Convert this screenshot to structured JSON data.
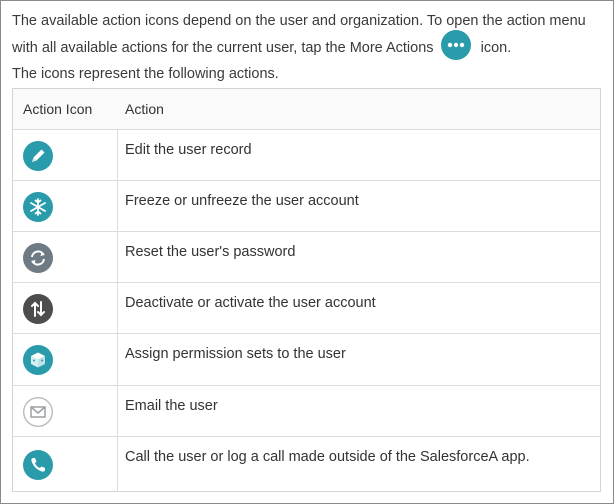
{
  "intro": {
    "text_before": "The available action icons depend on the user and organization. To open the action menu with all available actions for the current user, tap the More Actions",
    "text_after": "icon.",
    "more_actions_icon": "more-actions-icon"
  },
  "subintro": "The icons represent the following actions.",
  "table": {
    "headers": [
      "Action Icon",
      "Action"
    ],
    "rows": [
      {
        "icon": "edit-icon",
        "color": "#2a9bab",
        "action": "Edit the user record"
      },
      {
        "icon": "freeze-icon",
        "color": "#2a9bab",
        "action": "Freeze or unfreeze the user account"
      },
      {
        "icon": "reset-password-icon",
        "color": "#6f7b84",
        "action": "Reset the user's password"
      },
      {
        "icon": "deactivate-icon",
        "color": "#4d4d4d",
        "action": "Deactivate or activate the user account"
      },
      {
        "icon": "permission-sets-icon",
        "color": "#2a9bab",
        "action": "Assign permission sets to the user"
      },
      {
        "icon": "email-icon",
        "color": "#9aa0a4",
        "action": "Email the user"
      },
      {
        "icon": "call-icon",
        "color": "#2a9bab",
        "action": "Call the user or log a call made outside of the SalesforceA app."
      }
    ]
  }
}
